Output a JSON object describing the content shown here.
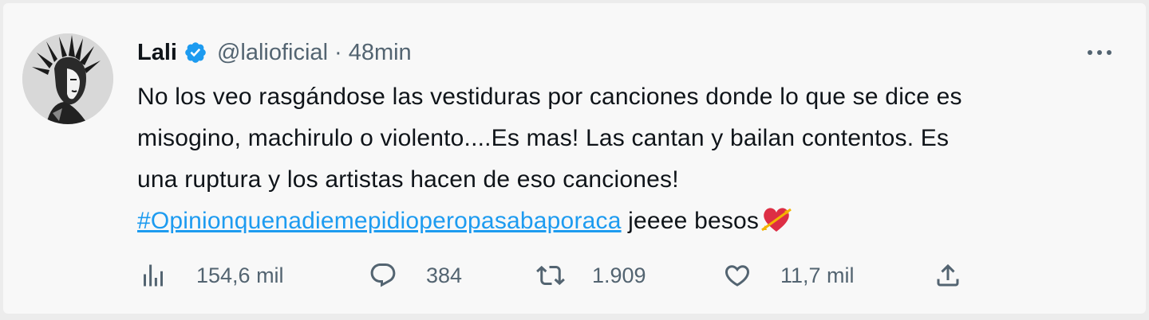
{
  "tweet": {
    "author": {
      "name": "Lali",
      "handle": "@lalioficial",
      "separator": "·",
      "time": "48min",
      "verified_icon": "verified-badge-icon",
      "avatar_icon": "avatar-image"
    },
    "text": {
      "line1": "No los veo rasgándose las vestiduras por canciones donde lo que se dice es",
      "line2": "misogino, machirulo o violento....Es mas! Las cantan y bailan contentos. Es",
      "line3": "una ruptura y los artistas hacen de eso canciones!",
      "hashtag": "#Opinionquenadiemepidioperopasabaporaca",
      "tail": " jeeee besos",
      "emoji": "heart-with-arrow-icon"
    },
    "actions": {
      "views": {
        "icon": "analytics-icon",
        "count": "154,6 mil"
      },
      "replies": {
        "icon": "reply-icon",
        "count": "384"
      },
      "retweets": {
        "icon": "retweet-icon",
        "count": "1.909"
      },
      "likes": {
        "icon": "heart-icon",
        "count": "11,7 mil"
      },
      "share": {
        "icon": "share-icon"
      }
    },
    "colors": {
      "accent": "#1d9bf0",
      "text": "#0f1419",
      "secondary": "#536471"
    }
  }
}
